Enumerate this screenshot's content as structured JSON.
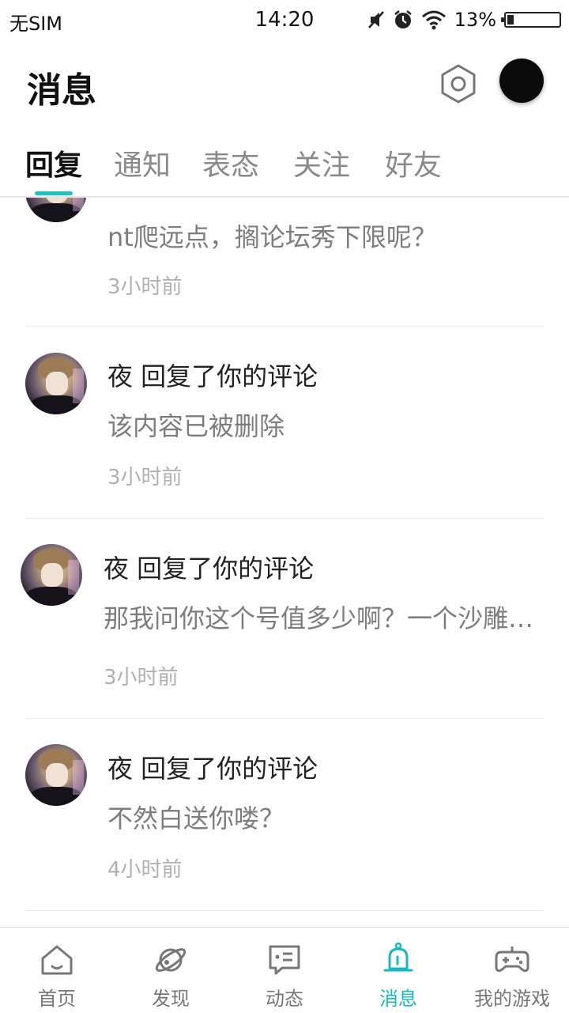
{
  "status_bar": {
    "carrier": "无SIM",
    "time": "14:20",
    "battery_percent": "13%",
    "battery_level": 0.13
  },
  "header": {
    "title": "消息"
  },
  "tabs": [
    {
      "label": "回复",
      "active": true
    },
    {
      "label": "通知",
      "active": false
    },
    {
      "label": "表态",
      "active": false
    },
    {
      "label": "关注",
      "active": false
    },
    {
      "label": "好友",
      "active": false
    }
  ],
  "messages": [
    {
      "title": "",
      "body": "nt爬远点，搁论坛秀下限呢？",
      "time": "3小时前"
    },
    {
      "title": "夜 回复了你的评论",
      "body": "该内容已被删除",
      "time": "3小时前"
    },
    {
      "title": "夜 回复了你的评论",
      "body": "那我问你这个号值多少啊？一个沙雕还当自己是个宝？",
      "time": "3小时前"
    },
    {
      "title": "夜 回复了你的评论",
      "body": "不然白送你喽？",
      "time": "4小时前"
    }
  ],
  "bottom_nav": [
    {
      "label": "首页",
      "icon": "home-icon",
      "active": false
    },
    {
      "label": "发现",
      "icon": "planet-icon",
      "active": false
    },
    {
      "label": "动态",
      "icon": "chat-icon",
      "active": false
    },
    {
      "label": "消息",
      "icon": "bell-icon",
      "active": true
    },
    {
      "label": "我的游戏",
      "icon": "gamepad-icon",
      "active": false
    }
  ],
  "colors": {
    "accent": "#17b8be",
    "text_primary": "#222222",
    "text_secondary": "#7d7d7d",
    "text_time": "#b0b0b0"
  }
}
